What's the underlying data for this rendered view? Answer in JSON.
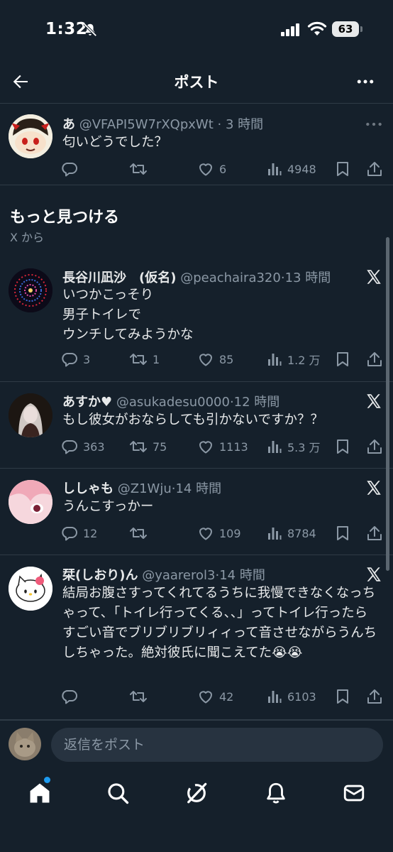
{
  "status_bar": {
    "time": "1:32",
    "battery": "63"
  },
  "header": {
    "title": "ポスト"
  },
  "main_tweet": {
    "name": "あ",
    "handle": "@VFAPI5W7rXQpxWt",
    "time": "3 時間",
    "text": "匂いどうでした？",
    "replies": "",
    "retweets": "",
    "likes": "6",
    "views": "4948"
  },
  "discover": {
    "title": "もっと見つける",
    "subtitle": "X から"
  },
  "tweets": [
    {
      "name": "長谷川凪沙　(仮名)",
      "handle": "@peachaira320",
      "time": "13 時間",
      "text": "いつかこっそり\n男子トイレで\nウンチしてみようかな",
      "replies": "3",
      "retweets": "1",
      "likes": "85",
      "views": "1.2 万"
    },
    {
      "name": "あすか♥",
      "handle": "@asukadesu0000",
      "time": "12 時間",
      "text": "もし彼女がおならしても引かないですか？？",
      "replies": "363",
      "retweets": "75",
      "likes": "1113",
      "views": "5.3 万"
    },
    {
      "name": "ししゃも",
      "handle": "@Z1Wju",
      "time": "14 時間",
      "text": "うんこすっかー",
      "replies": "12",
      "retweets": "",
      "likes": "109",
      "views": "8784"
    },
    {
      "name": "栞(しおり)ん",
      "handle": "@yaarerol3",
      "time": "14 時間",
      "text": "結局お腹さすってくれてるうちに我慢できなくなっちゃって、「トイレ行ってくる、、」ってトイレ行ったらすごい音でブリブリブリィィって音させながらうんちしちゃった。絶対彼氏に聞こえてた😭😭",
      "replies": "",
      "retweets": "",
      "likes": "42",
      "views": "6103"
    }
  ],
  "reply_bar": {
    "placeholder": "返信をポスト"
  },
  "tab_bar": {
    "items": [
      "home-icon",
      "search-icon",
      "grok-icon",
      "notifications-icon",
      "messages-icon"
    ]
  },
  "colors": {
    "background": "#15202b",
    "text": "#e7e9ea",
    "muted": "#8b98a5",
    "accent": "#1d9bf0",
    "divider": "#2f3b46"
  }
}
